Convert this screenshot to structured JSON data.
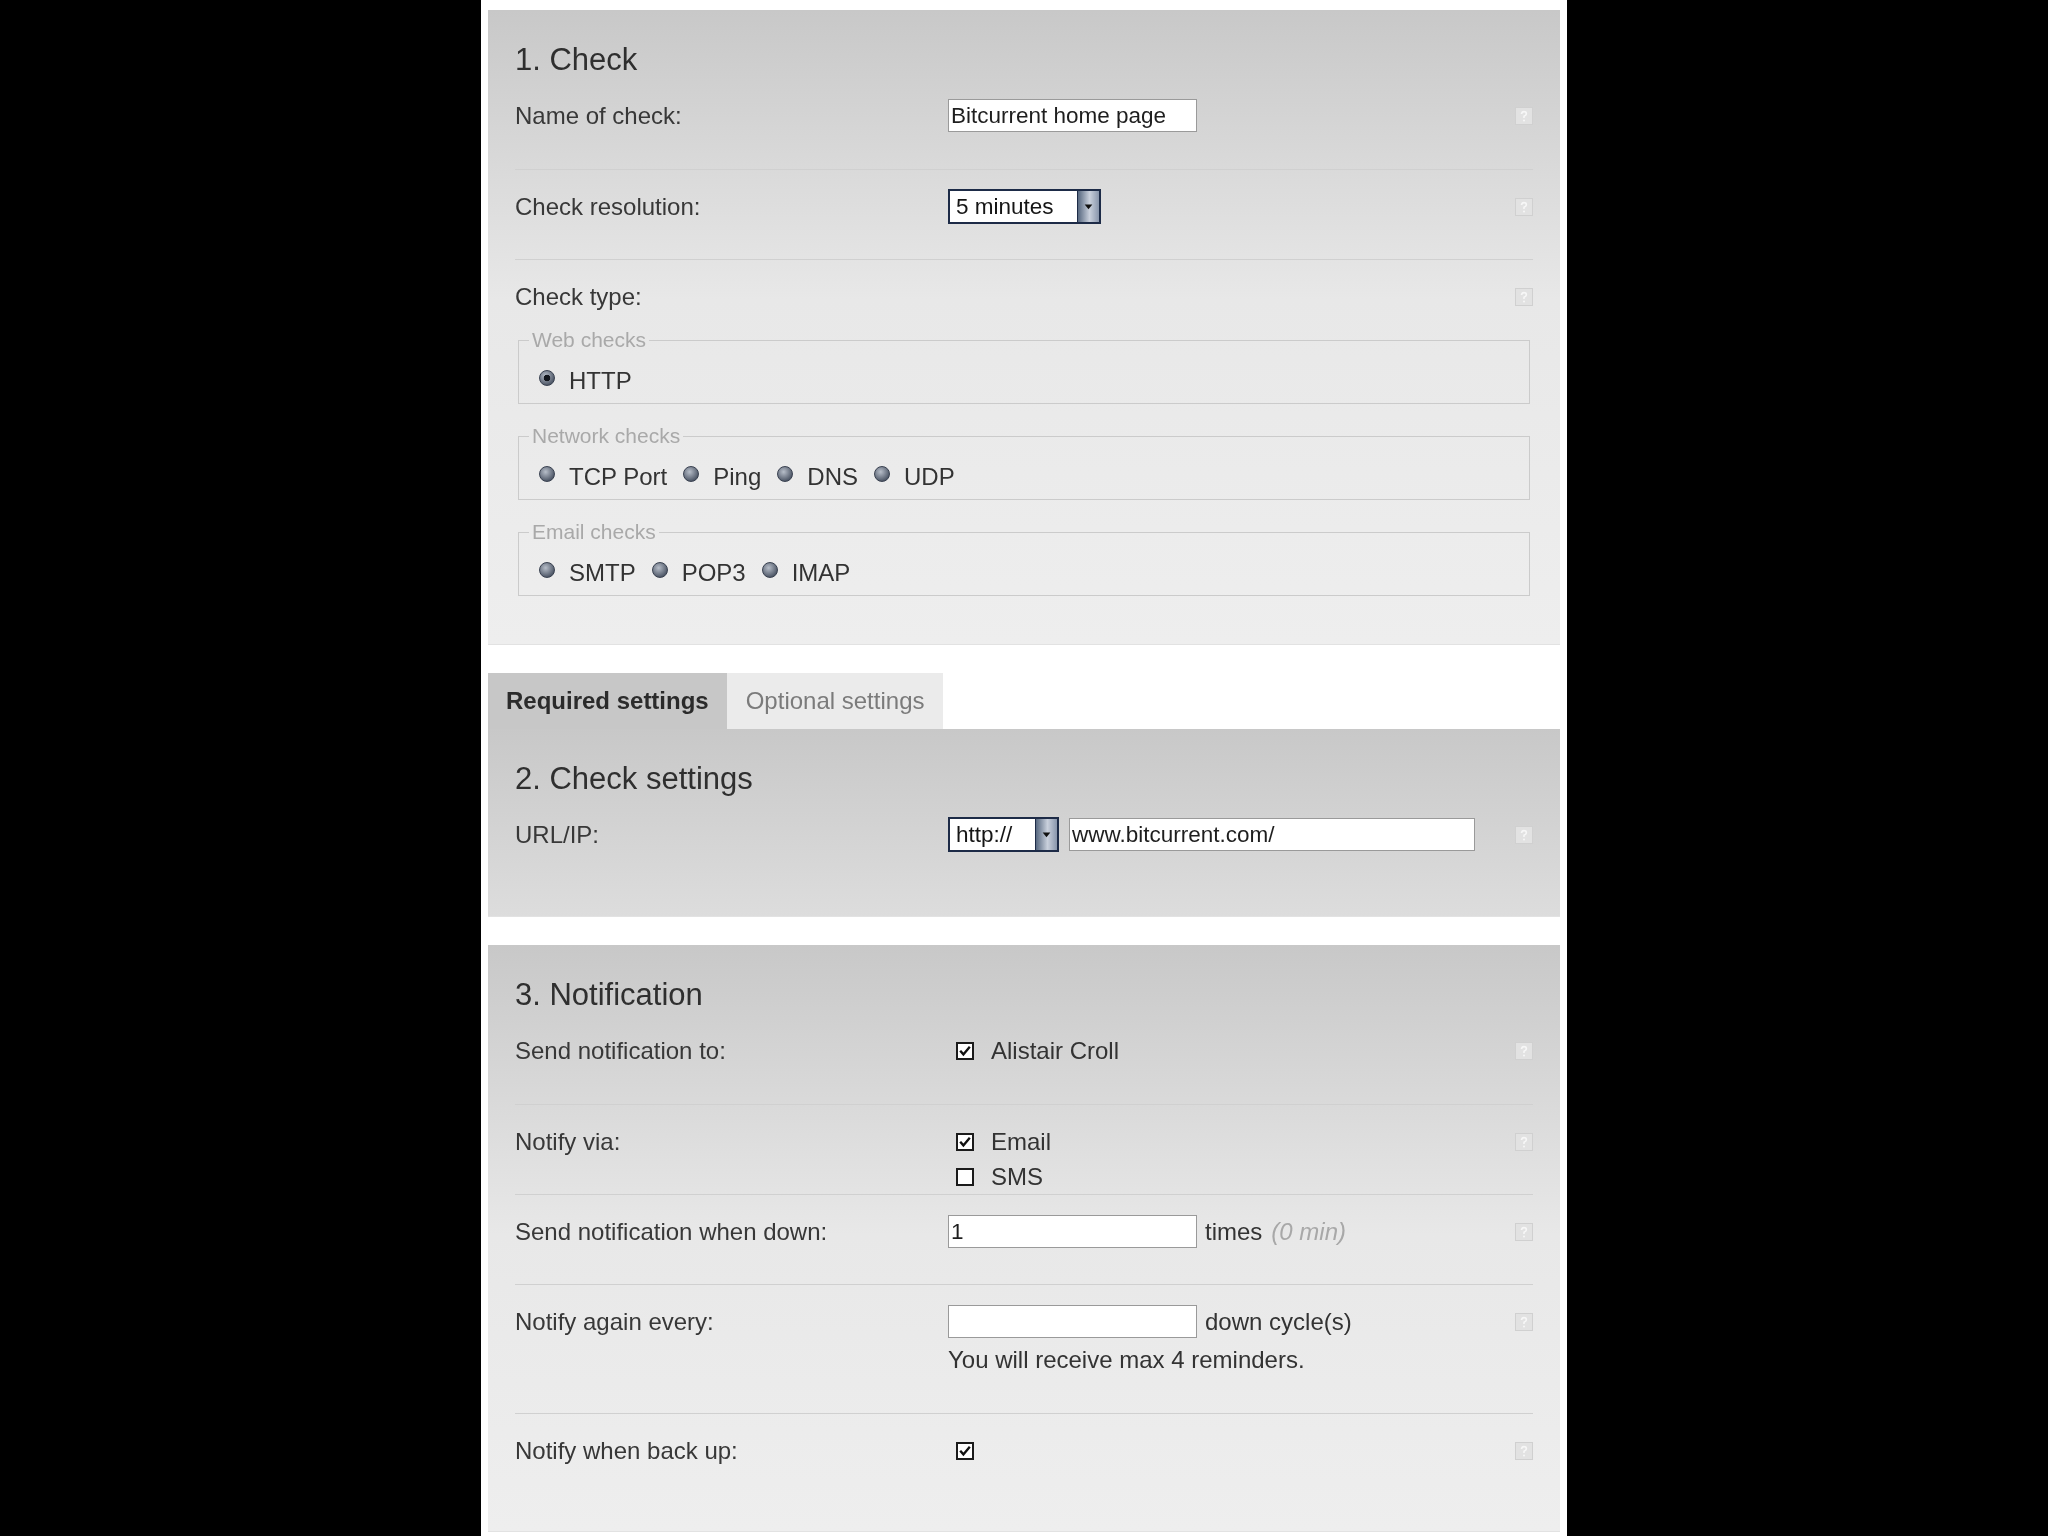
{
  "check": {
    "title": "1. Check",
    "rows": [
      {
        "kind": "text",
        "label": "Name of check:",
        "value": "Bitcurrent home page"
      },
      {
        "kind": "select",
        "label": "Check resolution:",
        "value": "5 minutes"
      },
      {
        "kind": "radios",
        "label": "Check type:",
        "groups": [
          {
            "legend": "Web checks",
            "options": [
              {
                "label": "HTTP",
                "selected": true
              }
            ]
          },
          {
            "legend": "Network checks",
            "options": [
              {
                "label": "TCP Port",
                "selected": false
              },
              {
                "label": "Ping",
                "selected": false
              },
              {
                "label": "DNS",
                "selected": false
              },
              {
                "label": "UDP",
                "selected": false
              }
            ]
          },
          {
            "legend": "Email checks",
            "options": [
              {
                "label": "SMTP",
                "selected": false
              },
              {
                "label": "POP3",
                "selected": false
              },
              {
                "label": "IMAP",
                "selected": false
              }
            ]
          }
        ]
      }
    ]
  },
  "tabs": [
    {
      "label": "Required settings",
      "selected": true
    },
    {
      "label": "Optional settings",
      "selected": false
    }
  ],
  "check_settings": {
    "title": "2. Check settings",
    "rows": [
      {
        "kind": "url",
        "label": "URL/IP:",
        "protocol": "http://",
        "value": "www.bitcurrent.com/"
      }
    ]
  },
  "notification": {
    "title": "3. Notification",
    "rows": [
      {
        "kind": "checks",
        "label": "Send notification to:",
        "options": [
          {
            "label": "Alistair Croll",
            "checked": true
          }
        ]
      },
      {
        "kind": "checks",
        "label": "Notify via:",
        "options": [
          {
            "label": "Email",
            "checked": true
          },
          {
            "label": "SMS",
            "checked": false
          }
        ]
      },
      {
        "kind": "text",
        "label": "Send notification when down:",
        "value": "1",
        "unit": "times",
        "note": "(0 min)"
      },
      {
        "kind": "text",
        "label": "Notify again every:",
        "unit": "down cycle(s)",
        "hint": "You will receive max 4 reminders."
      },
      {
        "kind": "checks",
        "label": "Notify when back up:",
        "options": [
          {
            "checked": true
          }
        ]
      }
    ]
  }
}
